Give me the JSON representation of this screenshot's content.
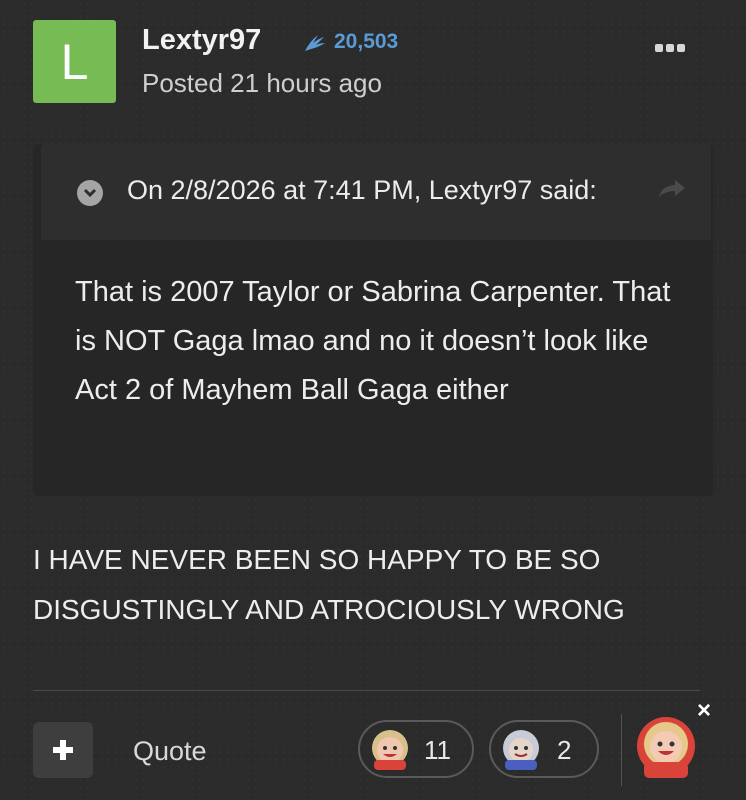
{
  "post": {
    "avatar_letter": "L",
    "avatar_color": "#77bb55",
    "username": "Lextyr97",
    "reputation": "20,503",
    "reputation_color": "#5b9bd5",
    "posted": "Posted 21 hours ago",
    "body": "I HAVE NEVER BEEN SO HAPPY TO BE SO DISGUSTINGLY AND ATROCIOUSLY WRONG"
  },
  "quote": {
    "citation": "On 2/8/2026 at 7:41 PM, Lextyr97 said:",
    "text": "That is 2007 Taylor or Sabrina Carpenter. That is NOT Gaga lmao and no it doesn’t look like Act 2 of Mayhem Ball Gaga either"
  },
  "footer": {
    "quote_label": "Quote",
    "reactions": [
      {
        "name": "LMAO",
        "count": "11"
      },
      {
        "name": "YAAAS",
        "count": "2"
      }
    ],
    "react_button_label": "LMAO",
    "close_symbol": "×"
  }
}
